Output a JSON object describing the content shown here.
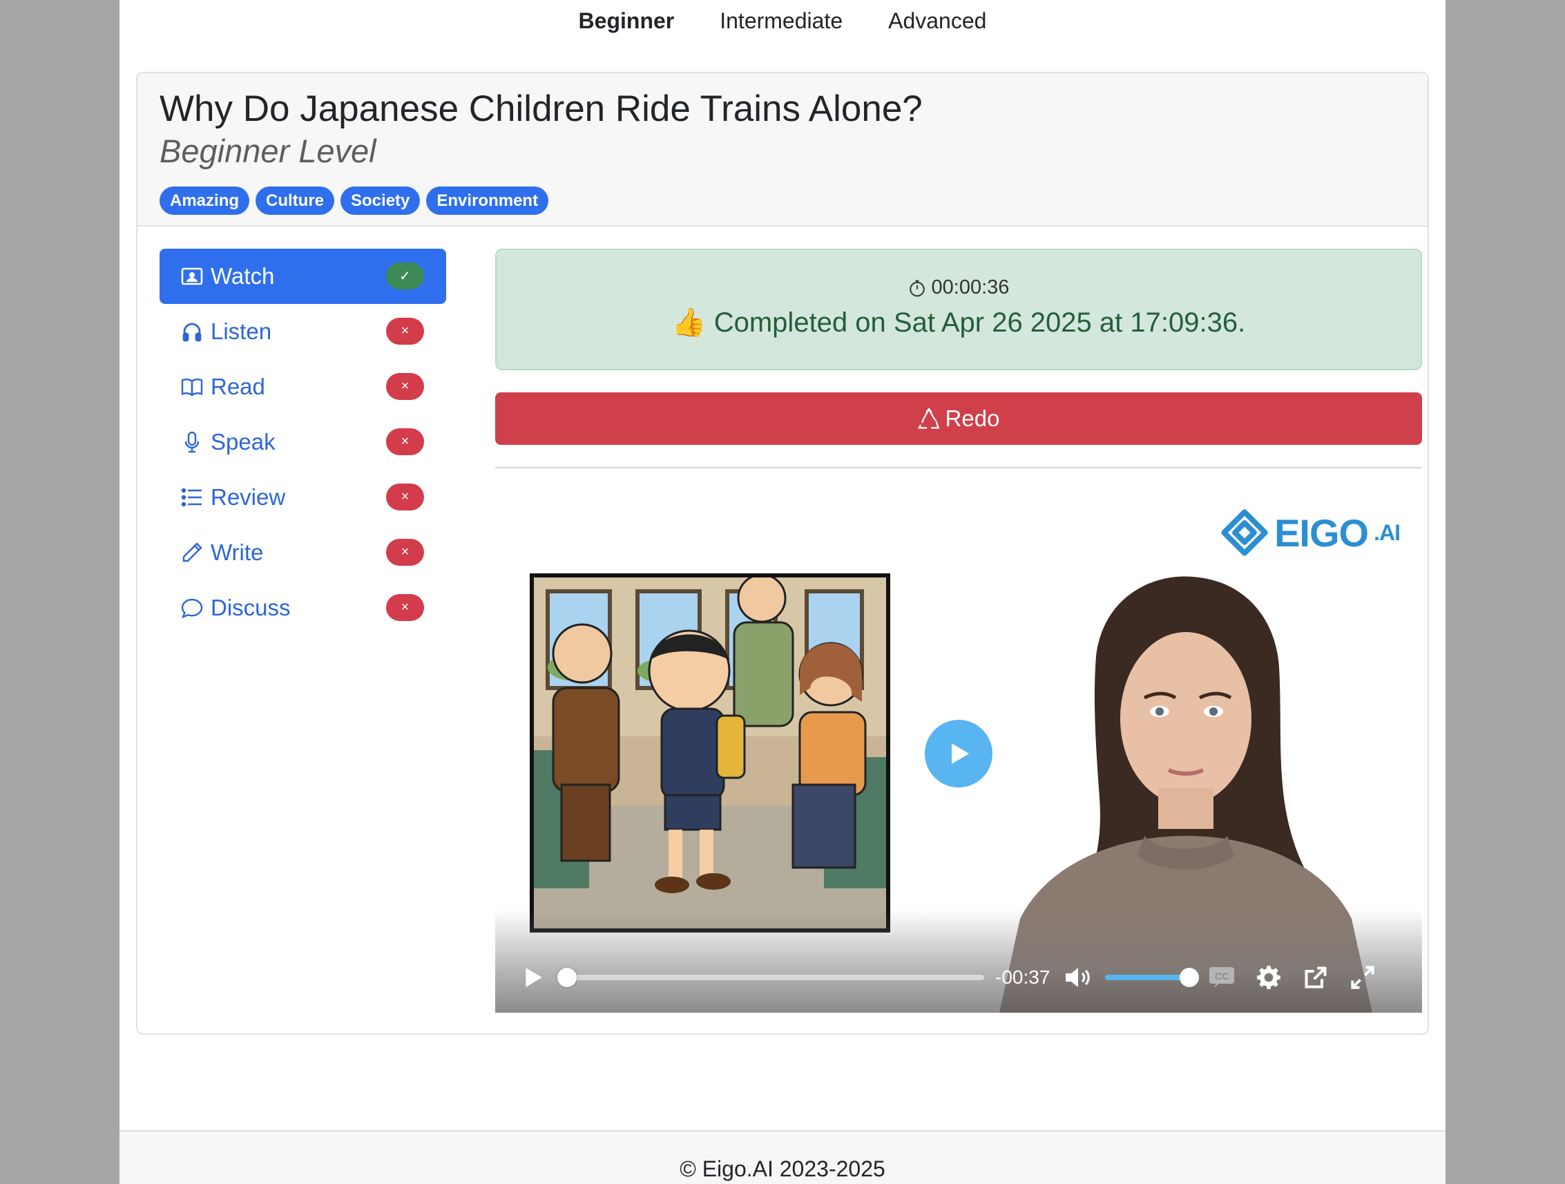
{
  "level_nav": {
    "items": [
      "Beginner",
      "Intermediate",
      "Advanced"
    ],
    "active": "Beginner"
  },
  "lesson": {
    "title": "Why Do Japanese Children Ride Trains Alone?",
    "subtitle": "Beginner Level",
    "tags": [
      "Amazing",
      "Culture",
      "Society",
      "Environment"
    ]
  },
  "sidebar": {
    "items": [
      {
        "label": "Watch",
        "icon": "person-video-icon",
        "status": "done",
        "status_glyph": "✓"
      },
      {
        "label": "Listen",
        "icon": "headphones-icon",
        "status": "todo",
        "status_glyph": "×"
      },
      {
        "label": "Read",
        "icon": "book-icon",
        "status": "todo",
        "status_glyph": "×"
      },
      {
        "label": "Speak",
        "icon": "microphone-icon",
        "status": "todo",
        "status_glyph": "×"
      },
      {
        "label": "Review",
        "icon": "list-icon",
        "status": "todo",
        "status_glyph": "×"
      },
      {
        "label": "Write",
        "icon": "pencil-icon",
        "status": "todo",
        "status_glyph": "×"
      },
      {
        "label": "Discuss",
        "icon": "chat-bubble-icon",
        "status": "todo",
        "status_glyph": "×"
      }
    ]
  },
  "completion": {
    "duration": "00:00:36",
    "message": "👍 Completed on Sat Apr 26 2025 at 17:09:36."
  },
  "redo_button": {
    "label": "Redo"
  },
  "video": {
    "logo_text": "EIGO",
    "logo_suffix": ".AI",
    "time_remaining": "-00:37",
    "progress": 0.0,
    "volume": 1.0,
    "cc_label": "CC"
  },
  "footer": {
    "copyright": "© Eigo.AI 2023-2025"
  },
  "colors": {
    "primary": "#2f6fed",
    "danger": "#cf404a",
    "success_badge": "#3d8a55",
    "alert_bg": "#d4e7dc",
    "alert_text": "#245e3a",
    "player_accent": "#59b4f2"
  }
}
